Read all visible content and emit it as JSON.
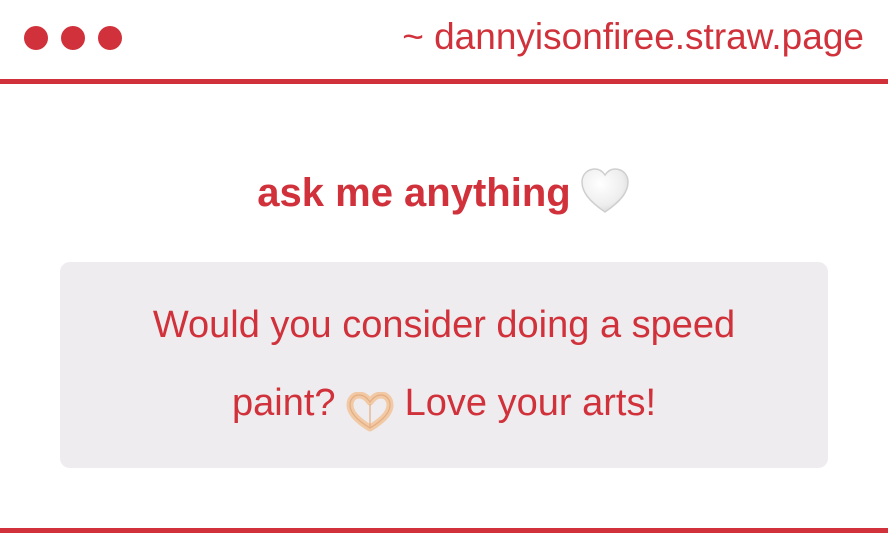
{
  "window": {
    "dots": [
      "close",
      "minimize",
      "maximize"
    ],
    "url": "~ dannyisonfiree.straw.page"
  },
  "content": {
    "heading": "ask me anything",
    "heading_icon": "white-heart-icon",
    "question_line1": "Would you consider doing a speed",
    "question_line2_before": "paint?",
    "question_icon": "heart-hands-icon",
    "question_line2_after": "Love your arts!"
  },
  "colors": {
    "accent": "#d0313a",
    "box_background": "#eeecee",
    "background": "#ffffff"
  }
}
